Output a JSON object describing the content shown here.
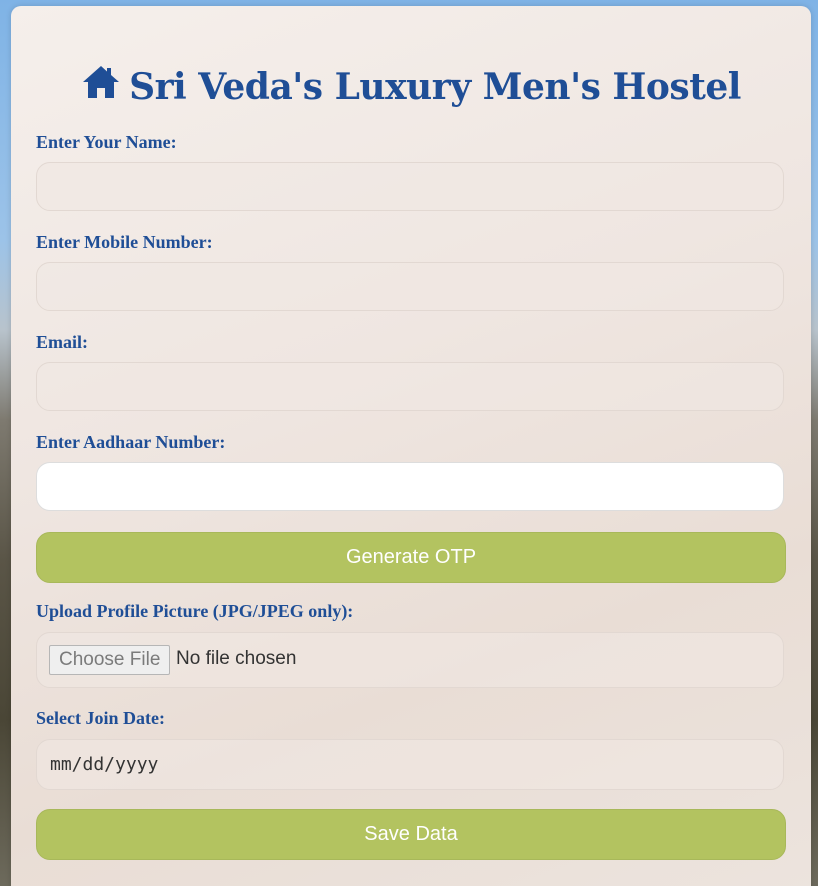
{
  "header": {
    "icon": "home-icon",
    "title": "Sri Veda's Luxury Men's Hostel"
  },
  "form": {
    "name_label": "Enter Your Name:",
    "name_value": "",
    "mobile_label": "Enter Mobile Number:",
    "mobile_value": "",
    "email_label": "Email:",
    "email_value": "",
    "aadhaar_label": "Enter Aadhaar Number:",
    "aadhaar_value": "",
    "generate_otp_label": "Generate OTP",
    "upload_label": "Upload Profile Picture (JPG/JPEG only):",
    "choose_file_label": "Choose File",
    "no_file_text": "No file chosen",
    "join_date_label": "Select Join Date:",
    "join_date_placeholder": "mm/dd/yyyy",
    "save_label": "Save Data"
  },
  "colors": {
    "accent": "#1f4e96",
    "button": "#b3c360"
  }
}
